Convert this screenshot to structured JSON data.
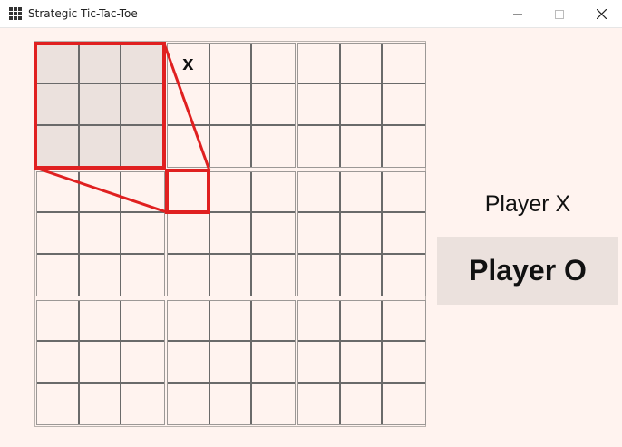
{
  "window": {
    "title": "Strategic Tic-Tac-Toe",
    "icon": "grid-icon",
    "controls": [
      "minimize-icon",
      "maximize-icon",
      "close-icon"
    ]
  },
  "board": {
    "active_subboard": 0,
    "highlight_color": "#e02020",
    "subboards": [
      [
        "",
        "",
        "",
        "",
        "",
        "",
        "",
        "",
        ""
      ],
      [
        "x",
        "",
        "",
        "",
        "",
        "",
        "",
        "",
        ""
      ],
      [
        "",
        "",
        "",
        "",
        "",
        "",
        "",
        "",
        ""
      ],
      [
        "",
        "",
        "",
        "",
        "",
        "",
        "",
        "",
        ""
      ],
      [
        "",
        "",
        "",
        "",
        "",
        "",
        "",
        "",
        ""
      ],
      [
        "",
        "",
        "",
        "",
        "",
        "",
        "",
        "",
        ""
      ],
      [
        "",
        "",
        "",
        "",
        "",
        "",
        "",
        "",
        ""
      ],
      [
        "",
        "",
        "",
        "",
        "",
        "",
        "",
        "",
        ""
      ],
      [
        "",
        "",
        "",
        "",
        "",
        "",
        "",
        "",
        ""
      ]
    ]
  },
  "players": {
    "x_label": "Player X",
    "o_label": "Player O",
    "current": "O"
  }
}
